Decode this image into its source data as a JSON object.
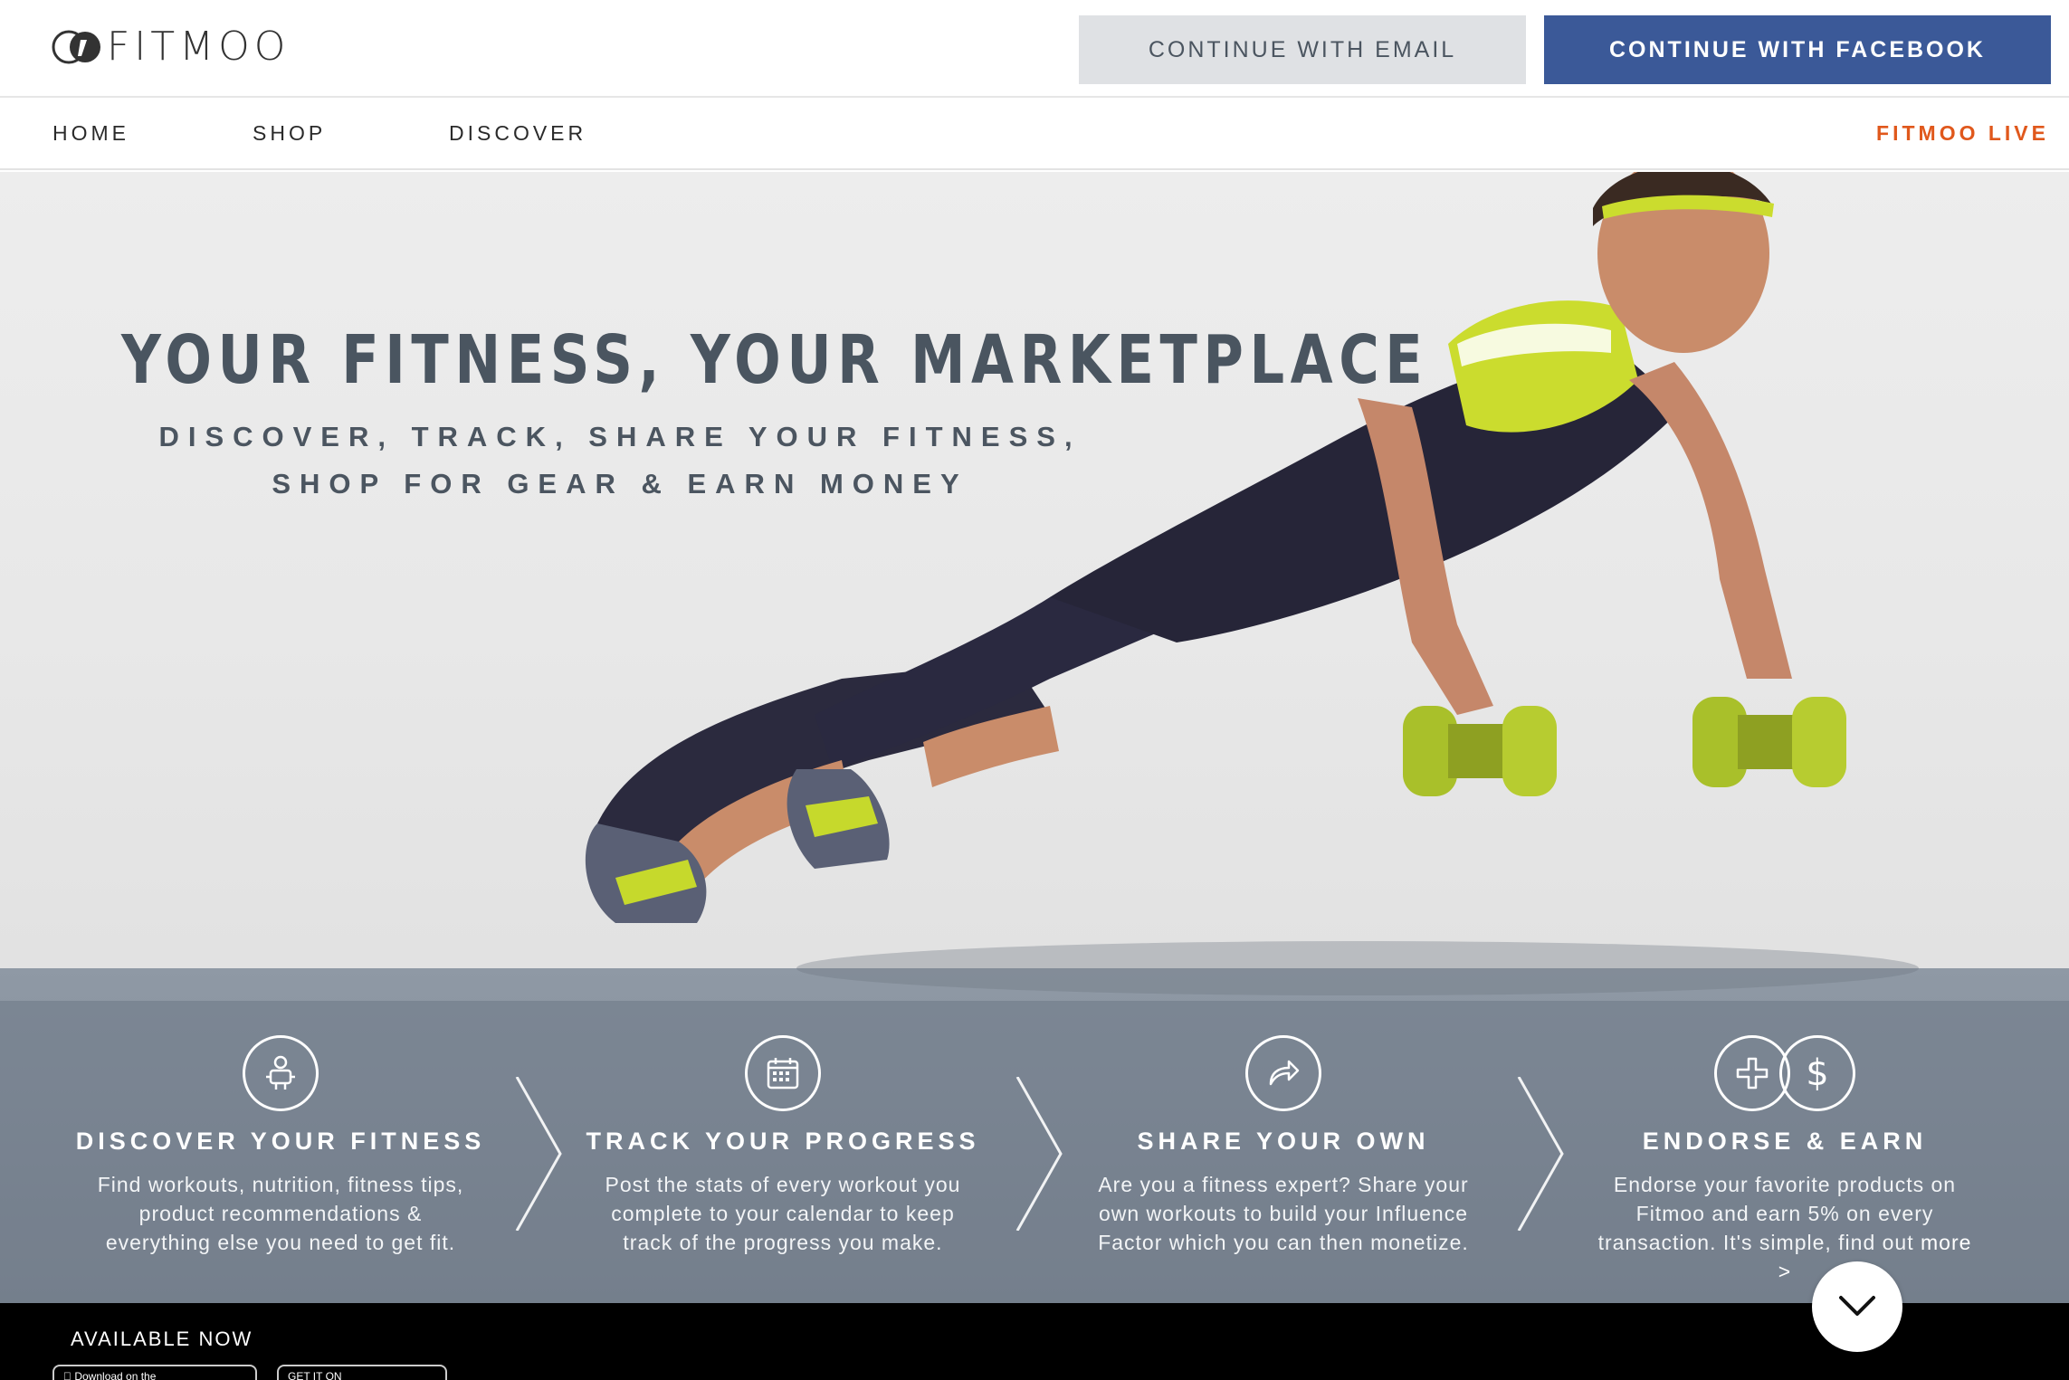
{
  "header": {
    "logo_text": "FITMOO",
    "email_button": "CONTINUE WITH EMAIL",
    "facebook_button": "CONTINUE WITH FACEBOOK"
  },
  "nav": {
    "home": "HOME",
    "shop": "SHOP",
    "discover": "DISCOVER",
    "live": "FITMOO LIVE"
  },
  "hero": {
    "headline": "YOUR FITNESS, YOUR MARKETPLACE",
    "subline_1": "DISCOVER, TRACK, SHARE YOUR FITNESS,",
    "subline_2": "SHOP FOR GEAR & EARN MONEY"
  },
  "features": [
    {
      "icon": "person-icon",
      "title": "DISCOVER YOUR FITNESS",
      "description": "Find workouts, nutrition, fitness tips, product recommendations & everything else you need to get fit."
    },
    {
      "icon": "calendar-icon",
      "title": "TRACK YOUR PROGRESS",
      "description": "Post the stats of every workout you complete to your calendar to keep track of the progress you make."
    },
    {
      "icon": "share-icon",
      "title": "SHARE YOUR OWN",
      "description": "Are you a fitness expert? Share your own workouts to build your Influence Factor which you can then monetize."
    },
    {
      "icon": "plus-dollar-icon",
      "title": "ENDORSE & EARN",
      "description": "Endorse your favorite products on Fitmoo and earn 5% on every transaction. It's simple, find out",
      "more_link": "more >"
    }
  ],
  "footer": {
    "available": "AVAILABLE NOW",
    "app_store": "Download on the",
    "google_play": "GET IT ON"
  },
  "colors": {
    "facebook_blue": "#3b5998",
    "live_orange": "#e0581c",
    "headline_slate": "#4a5560",
    "email_button_bg": "#dfe1e4"
  }
}
